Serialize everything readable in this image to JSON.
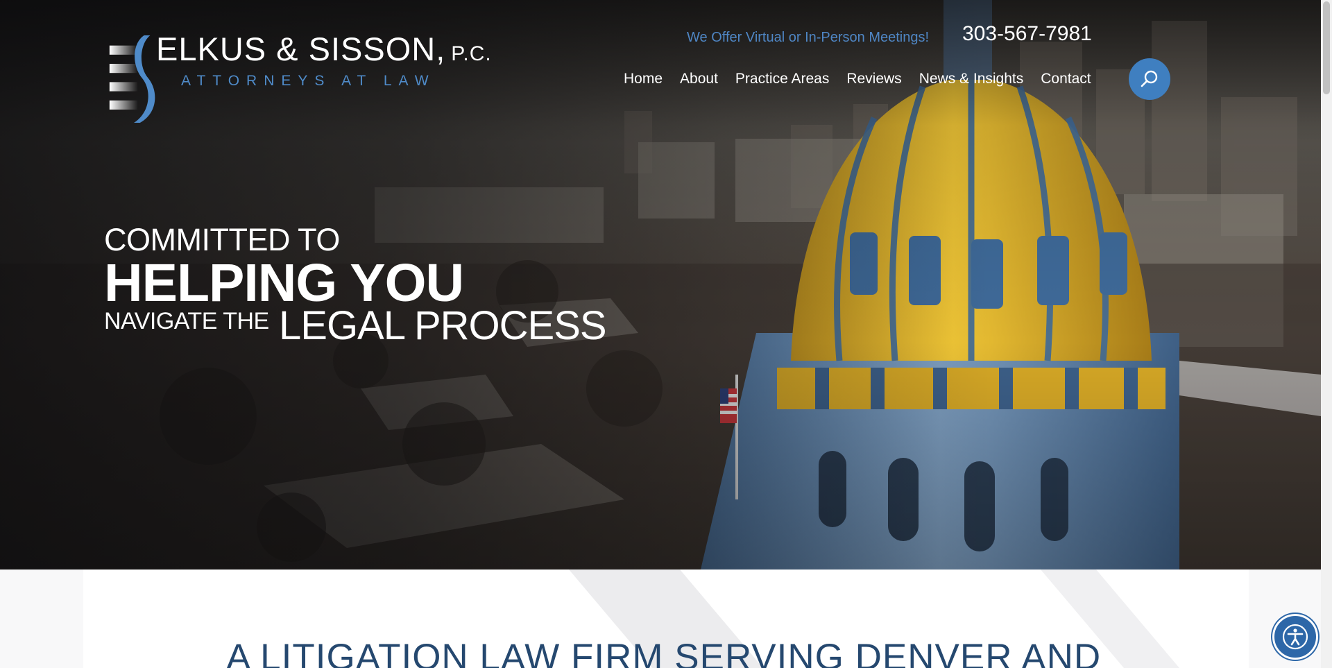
{
  "logo": {
    "name": "ELKUS & SISSON,",
    "suffix": "P.C.",
    "tagline": "ATTORNEYS AT LAW"
  },
  "header": {
    "meeting_note": "We Offer Virtual or In-Person Meetings!",
    "phone": "303-567-7981"
  },
  "nav": {
    "items": [
      {
        "label": "Home"
      },
      {
        "label": "About"
      },
      {
        "label": "Practice Areas"
      },
      {
        "label": "Reviews"
      },
      {
        "label": "News & Insights"
      },
      {
        "label": "Contact"
      }
    ],
    "search_icon": "search-icon"
  },
  "hero": {
    "line1": "COMMITTED TO",
    "line2": "HELPING YOU",
    "line3": "NAVIGATE THE",
    "line4": "LEGAL PROCESS"
  },
  "section": {
    "title": "A LITIGATION LAW FIRM SERVING DENVER AND"
  },
  "accessibility": {
    "icon": "accessibility-icon"
  },
  "colors": {
    "accent_blue": "#3f7fc0",
    "tagline_blue": "#4f86c4",
    "title_navy": "#25486f",
    "dome_gold": "#e2b52a"
  }
}
